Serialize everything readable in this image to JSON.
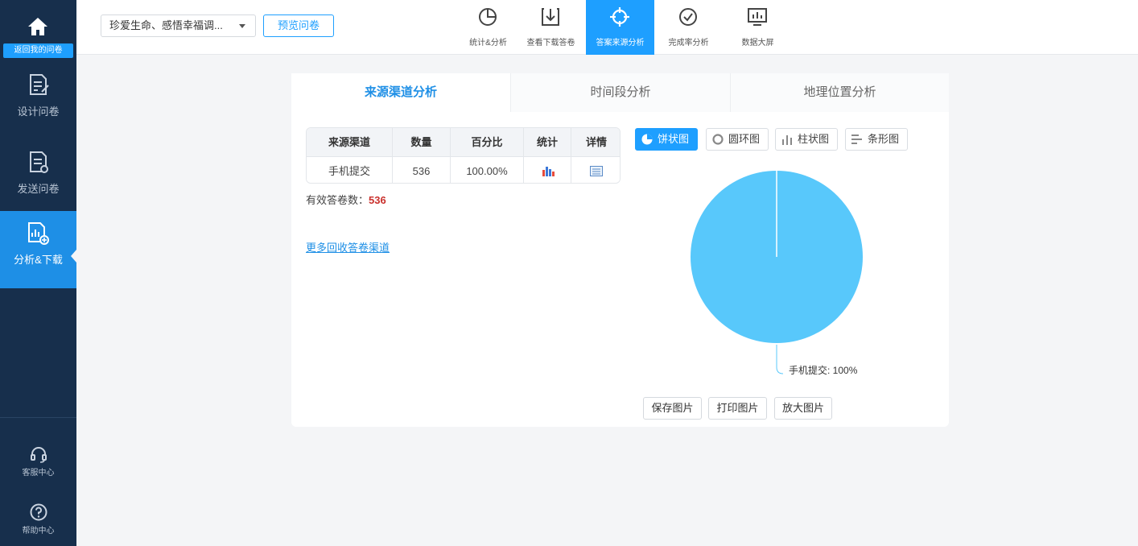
{
  "sidebar": {
    "home_label": "返回我的问卷",
    "items": [
      {
        "label": "设计问卷",
        "icon": "edit-doc-icon"
      },
      {
        "label": "发送问卷",
        "icon": "send-doc-icon"
      },
      {
        "label": "分析&下载",
        "icon": "analysis-download-icon"
      }
    ],
    "bottom": [
      {
        "label": "客服中心",
        "icon": "headset-icon"
      },
      {
        "label": "帮助中心",
        "icon": "help-icon"
      }
    ]
  },
  "topbar": {
    "survey_select": "珍爱生命、感悟幸福调...",
    "preview_label": "预览问卷",
    "tabs": [
      {
        "label": "统计&分析",
        "icon": "pie-chart-icon"
      },
      {
        "label": "查看下载答卷",
        "icon": "download-icon"
      },
      {
        "label": "答案来源分析",
        "icon": "crosshair-icon"
      },
      {
        "label": "完成率分析",
        "icon": "check-circle-icon"
      },
      {
        "label": "数据大屏",
        "icon": "monitor-chart-icon"
      }
    ]
  },
  "main": {
    "tabs": [
      {
        "label": "来源渠道分析"
      },
      {
        "label": "时间段分析"
      },
      {
        "label": "地理位置分析"
      }
    ],
    "table": {
      "headers": [
        "来源渠道",
        "数量",
        "百分比",
        "统计",
        "详情"
      ],
      "rows": [
        {
          "channel": "手机提交",
          "count": "536",
          "percent": "100.00%"
        }
      ]
    },
    "valid_label": "有效答卷数：",
    "valid_count": "536",
    "more_link": "更多回收答卷渠道",
    "chart_types": [
      {
        "label": "饼状图",
        "icon": "pie-icon"
      },
      {
        "label": "圆环图",
        "icon": "donut-icon"
      },
      {
        "label": "柱状图",
        "icon": "bar-icon"
      },
      {
        "label": "条形图",
        "icon": "hbar-icon"
      }
    ],
    "actions": [
      "保存图片",
      "打印图片",
      "放大图片"
    ]
  },
  "colors": {
    "sidebar_bg": "#172f4c",
    "accent": "#1e9fff",
    "pie": "#58c8fb"
  },
  "chart_data": {
    "type": "pie",
    "categories": [
      "手机提交"
    ],
    "values": [
      100
    ],
    "labels": [
      "手机提交: 100%"
    ]
  }
}
